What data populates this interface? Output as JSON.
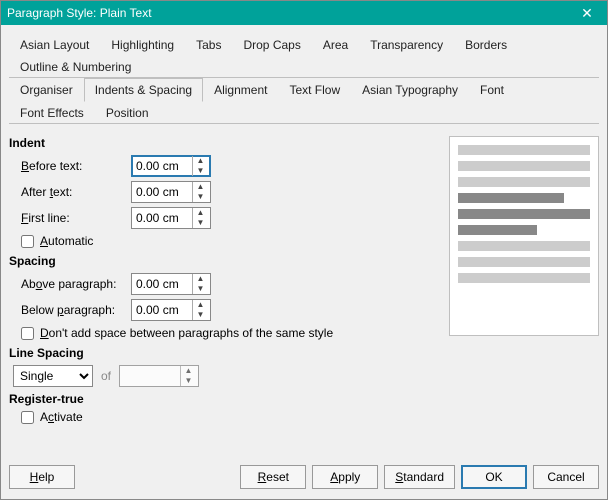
{
  "window": {
    "title": "Paragraph Style: Plain Text"
  },
  "tabs": {
    "row1": [
      "Asian Layout",
      "Highlighting",
      "Tabs",
      "Drop Caps",
      "Area",
      "Transparency",
      "Borders",
      "Outline & Numbering"
    ],
    "row2": [
      "Organiser",
      "Indents & Spacing",
      "Alignment",
      "Text Flow",
      "Asian Typography",
      "Font",
      "Font Effects",
      "Position"
    ],
    "active": "Indents & Spacing"
  },
  "sections": {
    "indent": {
      "title": "Indent",
      "before": {
        "label": "Before text:",
        "value": "0.00 cm"
      },
      "after": {
        "label": "After text:",
        "value": "0.00 cm"
      },
      "firstline": {
        "label": "First line:",
        "value": "0.00 cm"
      },
      "automatic": {
        "label": "Automatic",
        "checked": false
      }
    },
    "spacing": {
      "title": "Spacing",
      "above": {
        "label": "Above paragraph:",
        "value": "0.00 cm"
      },
      "below": {
        "label": "Below paragraph:",
        "value": "0.00 cm"
      },
      "dontadd": {
        "label": "Don't add space between paragraphs of the same style",
        "checked": false
      }
    },
    "linespacing": {
      "title": "Line Spacing",
      "mode": "Single",
      "of_label": "of",
      "of_value": ""
    },
    "register": {
      "title": "Register-true",
      "activate": {
        "label": "Activate",
        "checked": false
      }
    }
  },
  "buttons": {
    "help": "Help",
    "reset": "Reset",
    "apply": "Apply",
    "standard": "Standard",
    "ok": "OK",
    "cancel": "Cancel"
  }
}
